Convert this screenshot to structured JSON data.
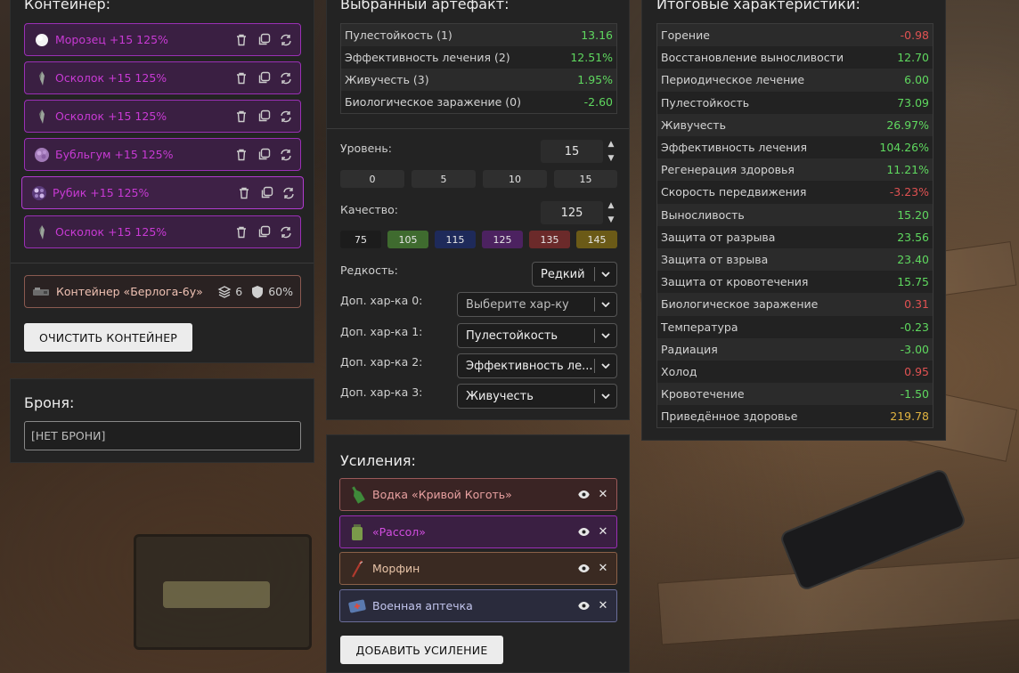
{
  "container": {
    "title": "Контейнер:",
    "items": [
      {
        "label": "Морозец +15 125%"
      },
      {
        "label": "Осколок +15 125%"
      },
      {
        "label": "Осколок +15 125%"
      },
      {
        "label": "Бубльгум +15 125%"
      },
      {
        "label": "Рубик +15 125%"
      },
      {
        "label": "Осколок +15 125%"
      }
    ],
    "selected": {
      "name": "Контейнер «Берлога-6у»",
      "slots": "6",
      "protection": "60%"
    },
    "clear_button": "ОЧИСТИТЬ КОНТЕЙНЕР"
  },
  "armor": {
    "title": "Броня:",
    "value": "[НЕТ БРОНИ]"
  },
  "artifact": {
    "title": "Выбранный артефакт:",
    "stats": [
      {
        "name": "Пулестойкость (1)",
        "value": "13.16",
        "tone": "pos"
      },
      {
        "name": "Эффективность лечения (2)",
        "value": "12.51%",
        "tone": "pos"
      },
      {
        "name": "Живучесть (3)",
        "value": "1.95%",
        "tone": "pos"
      },
      {
        "name": "Биологическое заражение (0)",
        "value": "-2.60",
        "tone": "pos"
      }
    ],
    "level_label": "Уровень:",
    "level_value": "15",
    "level_presets": [
      "0",
      "5",
      "10",
      "15"
    ],
    "quality_label": "Качество:",
    "quality_value": "125",
    "quality_presets": [
      {
        "label": "75",
        "color": "#1c1c1c"
      },
      {
        "label": "105",
        "color": "#3f6b2f"
      },
      {
        "label": "115",
        "color": "#1e2a5a"
      },
      {
        "label": "125",
        "color": "#4c2260"
      },
      {
        "label": "135",
        "color": "#6b2a2a"
      },
      {
        "label": "145",
        "color": "#6b5a17"
      }
    ],
    "rarity_label": "Редкость:",
    "rarity_value": "Редкий",
    "extra": [
      {
        "label": "Доп. хар-ка 0:",
        "value": "Выберите хар-ку"
      },
      {
        "label": "Доп. хар-ка 1:",
        "value": "Пулестойкость"
      },
      {
        "label": "Доп. хар-ка 2:",
        "value": "Эффективность ле..."
      },
      {
        "label": "Доп. хар-ка 3:",
        "value": "Живучесть"
      }
    ]
  },
  "boosts": {
    "title": "Усиления:",
    "items": [
      {
        "label": "Водка «Кривой Коготь»",
        "bg": "#3a2424",
        "border": "#9a5a5a",
        "text": "#e8a0a0"
      },
      {
        "label": "«Рассол»",
        "bg": "#3a1f42",
        "border": "#9a2fb5",
        "text": "#d24ee0"
      },
      {
        "label": "Морфин",
        "bg": "#3a2a22",
        "border": "#8a6048",
        "text": "#e8c4a8"
      },
      {
        "label": "Военная аптечка",
        "bg": "#2a2b3c",
        "border": "#6b6e9a",
        "text": "#c3c6ee"
      }
    ],
    "add_button": "ДОБАВИТЬ УСИЛЕНИЕ"
  },
  "totals": {
    "title": "Итоговые характеристики:",
    "stats": [
      {
        "name": "Горение",
        "value": "-0.98",
        "tone": "neg"
      },
      {
        "name": "Восстановление выносливости",
        "value": "12.70",
        "tone": "pos"
      },
      {
        "name": "Периодическое лечение",
        "value": "6.00",
        "tone": "pos"
      },
      {
        "name": "Пулестойкость",
        "value": "73.09",
        "tone": "pos"
      },
      {
        "name": "Живучесть",
        "value": "26.97%",
        "tone": "pos"
      },
      {
        "name": "Эффективность лечения",
        "value": "104.26%",
        "tone": "pos"
      },
      {
        "name": "Регенерация здоровья",
        "value": "11.21%",
        "tone": "pos"
      },
      {
        "name": "Скорость передвижения",
        "value": "-3.23%",
        "tone": "neg"
      },
      {
        "name": "Выносливость",
        "value": "15.20",
        "tone": "pos"
      },
      {
        "name": "Защита от разрыва",
        "value": "23.56",
        "tone": "pos"
      },
      {
        "name": "Защита от взрыва",
        "value": "23.40",
        "tone": "pos"
      },
      {
        "name": "Защита от кровотечения",
        "value": "15.75",
        "tone": "pos"
      },
      {
        "name": "Биологическое заражение",
        "value": "0.31",
        "tone": "neg"
      },
      {
        "name": "Температура",
        "value": "-0.23",
        "tone": "pos"
      },
      {
        "name": "Радиация",
        "value": "-3.00",
        "tone": "pos"
      },
      {
        "name": "Холод",
        "value": "0.95",
        "tone": "neg"
      },
      {
        "name": "Кровотечение",
        "value": "-1.50",
        "tone": "pos"
      },
      {
        "name": "Приведённое здоровье",
        "value": "219.78",
        "tone": "gold"
      }
    ]
  }
}
